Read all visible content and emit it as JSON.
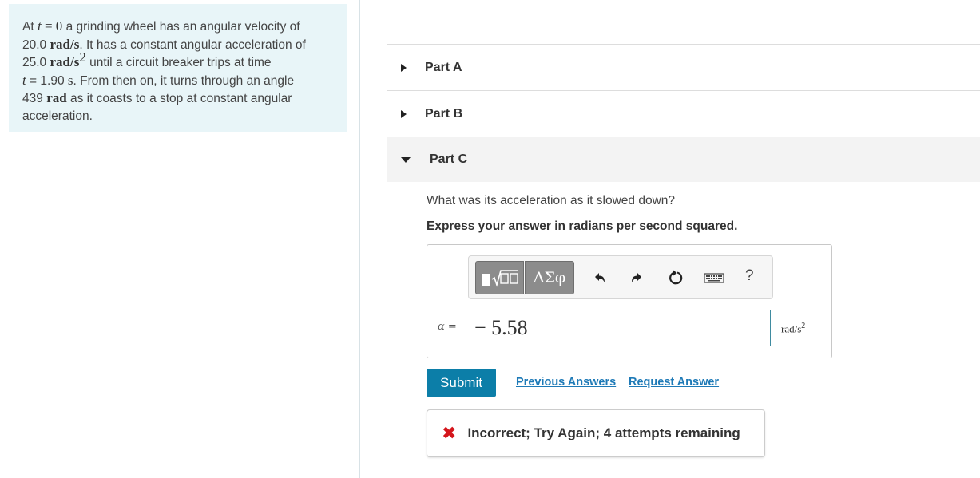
{
  "problem": {
    "seg1": "At ",
    "t_var": "t",
    "eq_zero": " = 0",
    "seg2": " a grinding wheel has an angular velocity of",
    "omega_value": "20.0",
    "omega_unit": "rad/s",
    "seg3": ". It has a constant angular acceleration of",
    "alpha_value": "25.0",
    "alpha_unit": "rad/s",
    "alpha_exp": "2",
    "seg4": " until a circuit breaker trips at time",
    "t_var2": "t",
    "seg5": " = 1.90 ",
    "s_unit": "s",
    "seg6": ". From then on, it turns through an angle",
    "angle_value": "439",
    "angle_unit": "rad",
    "seg7": " as it coasts to a stop at constant angular",
    "seg8": "acceleration."
  },
  "parts": {
    "a_label": "Part A",
    "b_label": "Part B",
    "c_label": "Part C"
  },
  "part_c": {
    "question": "What was its acceleration as it slowed down?",
    "instruction": "Express your answer in radians per second squared.",
    "toolbar": {
      "templates_icon": "templates-icon",
      "symbols_label": "ΑΣφ",
      "undo_icon": "undo-icon",
      "redo_icon": "redo-icon",
      "reset_icon": "reset-icon",
      "keyboard_icon": "keyboard-icon",
      "help_label": "?"
    },
    "variable_label": "α",
    "equals": " =",
    "answer_value": "− 5.58",
    "unit_base": "rad/s",
    "unit_exp": "2",
    "submit_label": "Submit",
    "previous_answers_label": "Previous Answers",
    "request_answer_label": "Request Answer",
    "feedback_icon": "✖",
    "feedback_text": "Incorrect; Try Again; 4 attempts remaining"
  },
  "colors": {
    "problem_bg": "#e8f5f8",
    "submit_bg": "#0c7ea8",
    "link": "#1e7ab7",
    "error": "#d4161c",
    "input_border": "#3f8ba0"
  }
}
